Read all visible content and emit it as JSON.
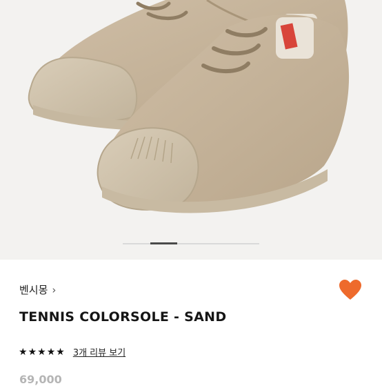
{
  "product": {
    "brand_name": "벤시몽",
    "brand_chevron": "›",
    "title": "TENNIS COLORSOLE - SAND",
    "rating": 5,
    "star_glyphs": [
      "★",
      "★",
      "★",
      "★",
      "★"
    ],
    "review_link_text": "3개 리뷰 보기",
    "price": "69,000"
  },
  "gallery": {
    "current_slide": 2,
    "image_subject": "shoes-photo"
  },
  "wishlist": {
    "icon": "heart-icon",
    "color": "#ee6a2c"
  },
  "colors": {
    "shoe_upper": "#c7b59c",
    "shoe_sole": "#cbbea7",
    "background": "#f3f2f0",
    "star": "#111111",
    "price_muted": "#b5b5b5"
  }
}
